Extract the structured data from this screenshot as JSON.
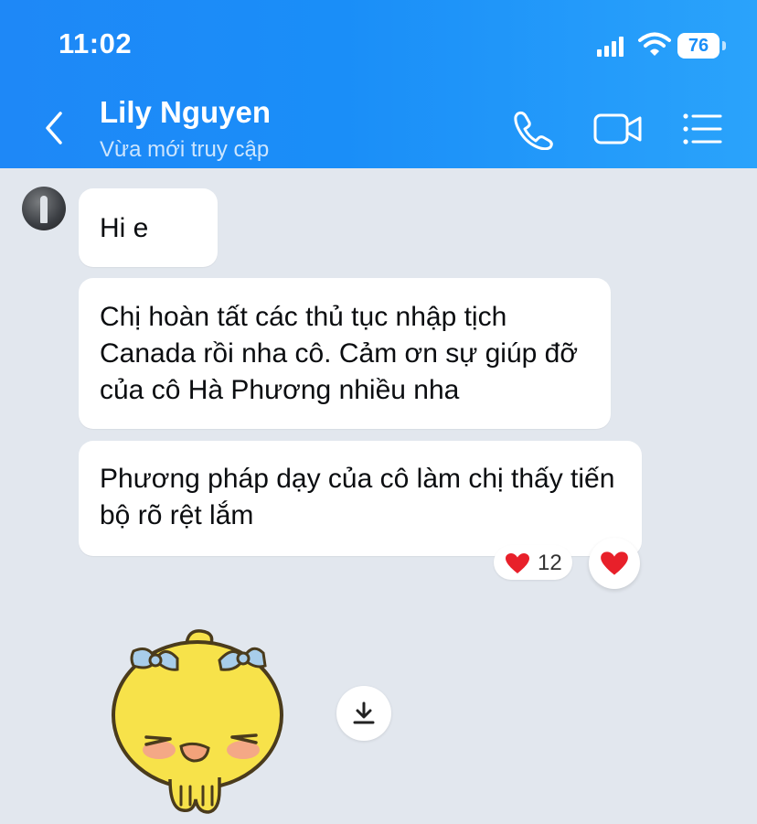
{
  "status_bar": {
    "time": "11:02",
    "battery": "76"
  },
  "header": {
    "contact_name": "Lily Nguyen",
    "contact_status": "Vừa mới truy cập"
  },
  "messages": [
    {
      "text": "Hi e"
    },
    {
      "text": "Chị hoàn tất các thủ tục nhập tịch Canada rồi nha cô. Cảm ơn sự giúp đỡ của cô Hà Phương nhiều nha"
    },
    {
      "text": "Phương pháp dạy của cô làm chị thấy tiến bộ rõ rệt lắm"
    }
  ],
  "reaction": {
    "emoji": "heart",
    "count": "12"
  },
  "colors": {
    "header_start": "#1e88f7",
    "header_end": "#2aa3fb",
    "chat_bg": "#e2e7ee",
    "heart": "#e8202a"
  },
  "icons": {
    "back": "chevron-left-icon",
    "call": "phone-icon",
    "video": "video-camera-icon",
    "menu": "list-menu-icon",
    "download": "download-icon"
  }
}
